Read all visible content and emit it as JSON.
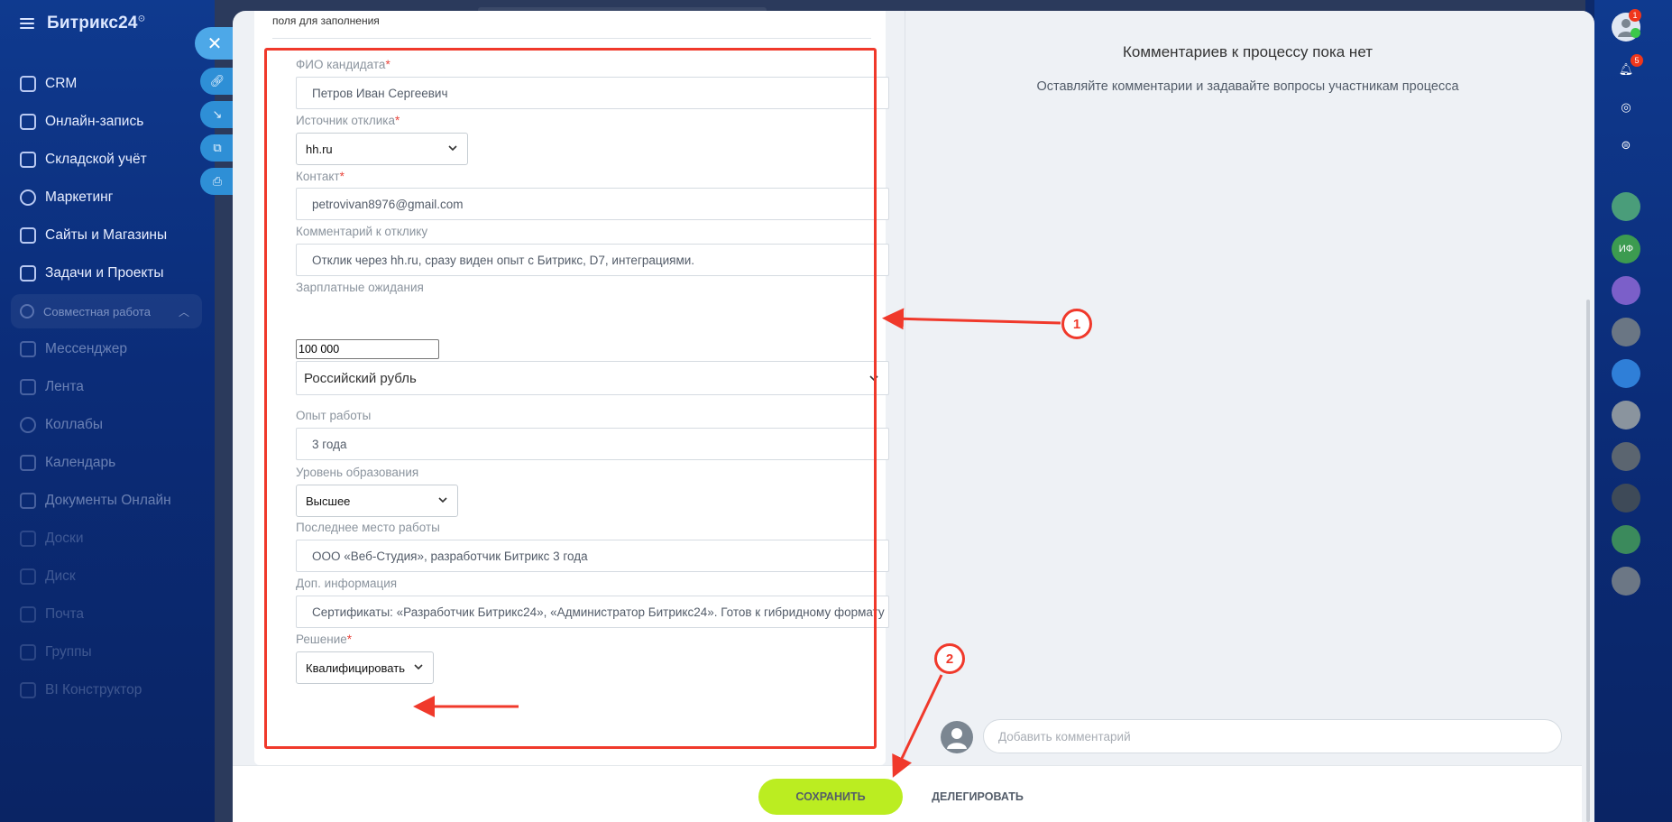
{
  "brand": {
    "name": "Битрикс24",
    "mark": "⊙"
  },
  "nav": {
    "items": [
      {
        "label": "CRM"
      },
      {
        "label": "Онлайн-запись"
      },
      {
        "label": "Складской учёт"
      },
      {
        "label": "Маркетинг"
      },
      {
        "label": "Сайты и Магазины"
      },
      {
        "label": "Задачи и Проекты"
      }
    ],
    "group_label": "Совместная работа",
    "group_items": [
      {
        "label": "Мессенджер"
      },
      {
        "label": "Лента"
      },
      {
        "label": "Коллабы"
      },
      {
        "label": "Календарь"
      },
      {
        "label": "Документы Онлайн"
      },
      {
        "label": "Доски"
      },
      {
        "label": "Диск"
      },
      {
        "label": "Почта"
      },
      {
        "label": "Группы"
      },
      {
        "label": "BI Конструктор"
      }
    ]
  },
  "form": {
    "section_title": "поля для заполнения",
    "fio": {
      "label": "ФИО кандидата",
      "value": "Петров Иван Сергеевич"
    },
    "source": {
      "label": "Источник отклика",
      "value": "hh.ru"
    },
    "contact": {
      "label": "Контакт",
      "value": "petrovivan8976@gmail.com"
    },
    "comment": {
      "label": "Комментарий к отклику",
      "value": "Отклик через hh.ru, сразу виден опыт с Битрикс, D7, интеграциями."
    },
    "salary": {
      "label": "Зарплатные ожидания",
      "value": "100 000",
      "currency": "Российский рубль"
    },
    "experience": {
      "label": "Опыт работы",
      "value": "3 года"
    },
    "education": {
      "label": "Уровень образования",
      "value": "Высшее"
    },
    "last_job": {
      "label": "Последнее место работы",
      "value": "ООО «Веб-Студия», разработчик Битрикс 3 года"
    },
    "extra": {
      "label": "Доп. информация",
      "value": "Сертификаты: «Разработчик Битрикс24», «Администратор Битрикс24». Готов к гибридному формату"
    },
    "decision": {
      "label": "Решение",
      "value": "Квалифицировать"
    },
    "required_mark": "*"
  },
  "comments": {
    "empty_title": "Комментариев к процессу пока нет",
    "empty_subtitle": "Оставляйте комментарии и задавайте вопросы участникам процесса",
    "input_placeholder": "Добавить комментарий"
  },
  "footer": {
    "save_label": "Сохранить",
    "delegate_label": "Делегировать"
  },
  "rail": {
    "profile_badge": "1",
    "notifications_badge": "5",
    "avatar_initials": "ИФ"
  },
  "annotations": {
    "marker_1": "1",
    "marker_2": "2"
  },
  "colors": {
    "accent_green": "#bbed21",
    "annotation_red": "#f0392b",
    "nav_bg": "#0b2c78",
    "required_red": "#e8453c"
  }
}
